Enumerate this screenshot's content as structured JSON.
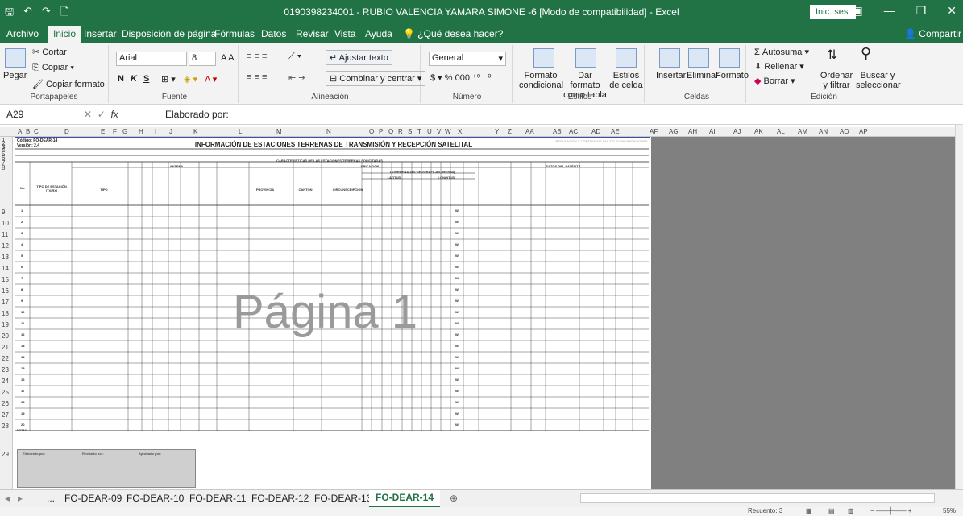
{
  "window": {
    "title": "0190398234001 - RUBIO VALENCIA YAMARA SIMONE -6 [Modo de compatibilidad] - Excel",
    "signin_label": "Inic. ses.",
    "share_label": "Compartir"
  },
  "ribbon_tabs": [
    "Archivo",
    "Inicio",
    "Insertar",
    "Disposición de página",
    "Fórmulas",
    "Datos",
    "Revisar",
    "Vista",
    "Ayuda",
    "¿Qué desea hacer?"
  ],
  "clipboard": {
    "paste": "Pegar",
    "cut": "Cortar",
    "copy": "Copiar",
    "format_painter": "Copiar formato",
    "label": "Portapapeles"
  },
  "font": {
    "name": "Arial",
    "size": "8",
    "label": "Fuente",
    "bold": "N",
    "italic": "K",
    "underline": "S"
  },
  "alignment": {
    "wrap": "Ajustar texto",
    "merge": "Combinar y centrar",
    "label": "Alineación"
  },
  "number": {
    "format": "General",
    "label": "Número"
  },
  "styles": {
    "conditional": "Formato condicional",
    "table": "Dar formato como tabla",
    "cell": "Estilos de celda",
    "label": "Estilos"
  },
  "cells": {
    "insert": "Insertar",
    "delete": "Eliminar",
    "format": "Formato",
    "label": "Celdas"
  },
  "editing": {
    "autosum": "Autosuma",
    "fill": "Rellenar",
    "clear": "Borrar",
    "sort": "Ordenar y filtrar",
    "find": "Buscar y seleccionar",
    "label": "Edición"
  },
  "formula_bar": {
    "name_box": "A29",
    "formula": "Elaborado por:"
  },
  "columns": [
    "A",
    "B",
    "C",
    "D",
    "E",
    "F",
    "G",
    "H",
    "I",
    "J",
    "K",
    "L",
    "M",
    "N",
    "O",
    "P",
    "Q",
    "R",
    "S",
    "T",
    "U",
    "V",
    "W",
    "X",
    "Y",
    "Z",
    "AA",
    "AB",
    "AC",
    "AD",
    "AE",
    "AF",
    "AG",
    "AH",
    "AI",
    "AJ",
    "AK",
    "AL",
    "AM",
    "AN",
    "AO",
    "AP"
  ],
  "rows": [
    "1",
    "2",
    "3",
    "4",
    "5",
    "6",
    "7",
    "8",
    "9",
    "10",
    "11",
    "12",
    "13",
    "14",
    "15",
    "16",
    "17",
    "18",
    "19",
    "20",
    "21",
    "22",
    "23",
    "24",
    "25",
    "26",
    "27",
    "28",
    "29"
  ],
  "document": {
    "code": "Código: FO-DEAR-14",
    "version": "Versión: 2.4",
    "title": "INFORMACIÓN DE ESTACIONES TERRENAS DE TRANSMISIÓN Y RECEPCIÓN SATELITAL",
    "agency": "REGULACIÓN Y CONTROL DE LAS TELECOMUNICACIONES",
    "section": "CARACTERÍSTICAS DE LAS ESTACIONES TERRENAS SOLICITADAS",
    "antenna": "ANTENA",
    "location": "UBICACIÓN",
    "satellite": "DATOS DEL SATÉLITE",
    "coords": "COORDENADAS GEOGRÁFICAS (WGS84)",
    "latitude": "LATITUD",
    "longitude": "LONGITUD",
    "no": "No.",
    "station_type": "TIPO DE ESTACIÓN (TX/RX)",
    "tipo": "TIPO",
    "province": "PROVINCIA",
    "canton": "CANTÓN",
    "parish": "CIRCUNSCRIPCIÓN",
    "row_numbers": [
      "1",
      "2",
      "3",
      "4",
      "5",
      "6",
      "7",
      "8",
      "9",
      "10",
      "11",
      "12",
      "13",
      "14",
      "15",
      "16",
      "17",
      "18",
      "19",
      "20"
    ],
    "w_mark": "W",
    "notes_title": "NOTAS:",
    "made_by": "Elaborado por:",
    "reviewed_by": "Revisado por:",
    "approved_by": "Aprobado por:",
    "watermark": "Página 1"
  },
  "sheet_tabs": [
    "...",
    "FO-DEAR-09",
    "FO-DEAR-10",
    "FO-DEAR-11",
    "FO-DEAR-12",
    "FO-DEAR-13",
    "FO-DEAR-14"
  ],
  "active_sheet": "FO-DEAR-14",
  "status": {
    "count": "Recuento: 3",
    "zoom": "55%"
  }
}
